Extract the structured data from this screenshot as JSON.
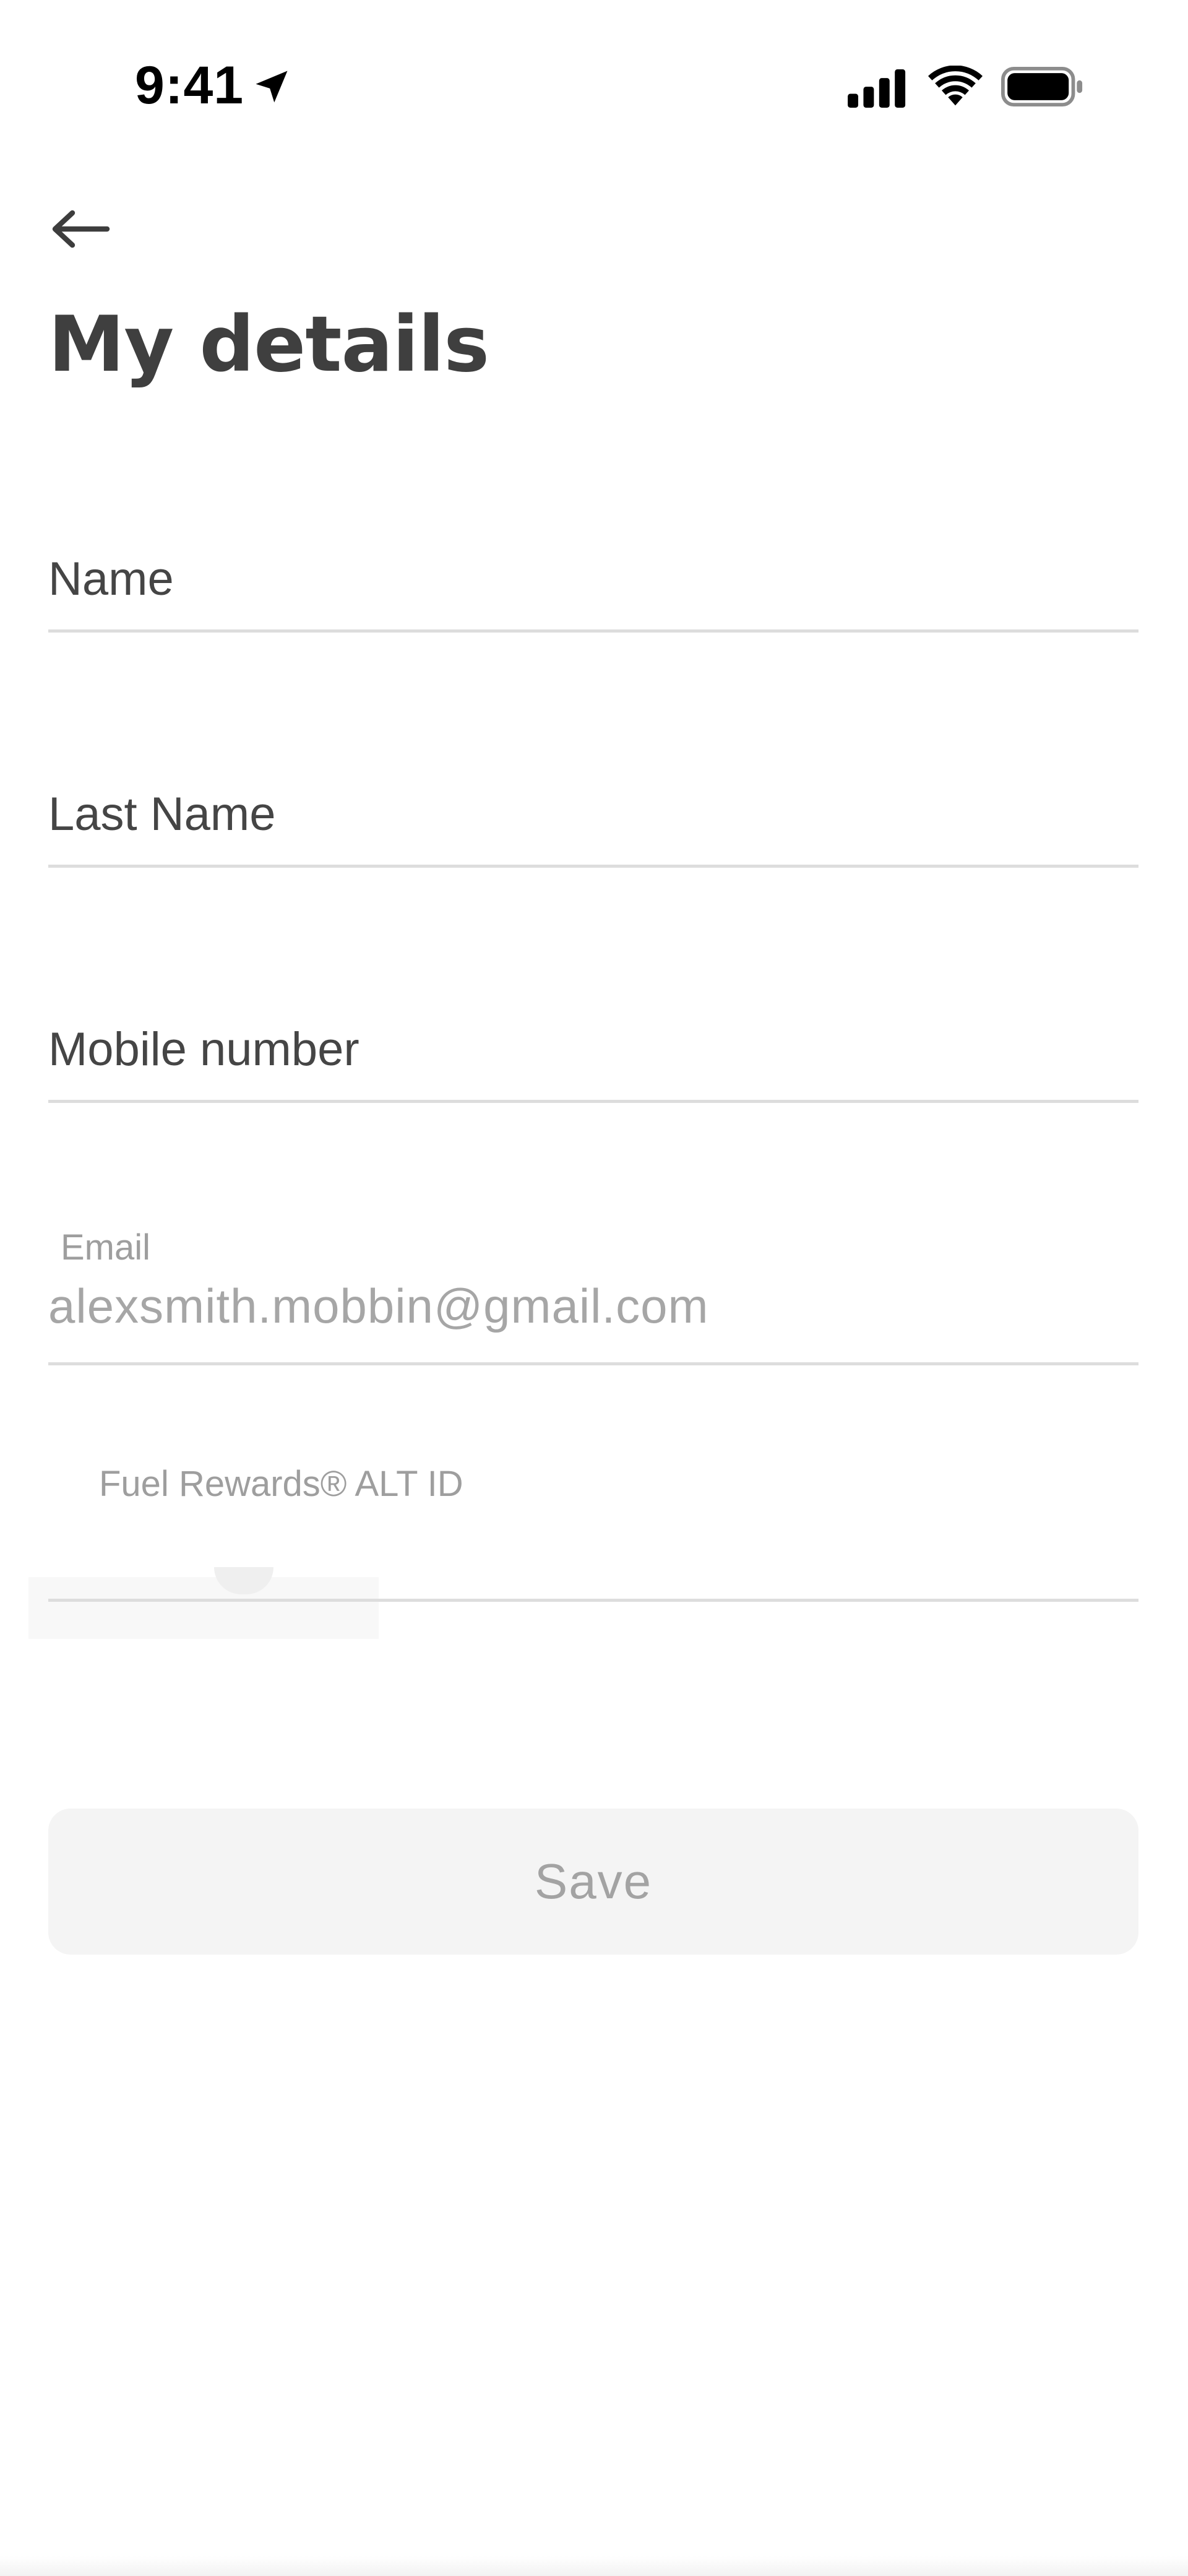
{
  "status_bar": {
    "time": "9:41",
    "icons": [
      "location-arrow-icon",
      "cellular-signal-icon",
      "wifi-icon",
      "battery-icon"
    ]
  },
  "header": {
    "back_icon": "arrow-left-icon",
    "title": "My details"
  },
  "form": {
    "name": {
      "label": "Name",
      "value": ""
    },
    "last_name": {
      "label": "Last Name",
      "value": ""
    },
    "mobile": {
      "label": "Mobile number",
      "value": ""
    },
    "email": {
      "label": "Email",
      "value": "alexsmith.mobbin@gmail.com"
    },
    "alt_id": {
      "label": "Fuel Rewards® ALT ID",
      "value": ""
    }
  },
  "actions": {
    "save_label": "Save"
  },
  "colors": {
    "title": "#3f3f3f",
    "label": "#454545",
    "muted": "#a6a6a6",
    "divider": "#dddddd",
    "button_bg": "#f4f4f4"
  }
}
